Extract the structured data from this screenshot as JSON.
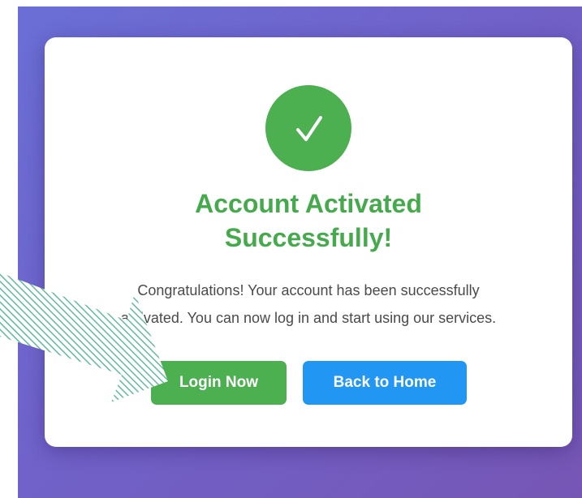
{
  "card": {
    "title_line1": "Account Activated",
    "title_line2": "Successfully!",
    "message_line1": "Congratulations! Your account has been successfully",
    "message_line2": "activated. You can now log in and start using our services.",
    "success_icon": "checkmark-icon"
  },
  "actions": {
    "login_label": "Login Now",
    "home_label": "Back to Home"
  },
  "overlay": {
    "annotation": "hatched-arrow-pointing-to-login"
  },
  "colors": {
    "success_green": "#4caf50",
    "title_green": "#45aa4c",
    "primary_blue": "#2196f3",
    "background_gradient_start": "#6a6fd6",
    "background_gradient_end": "#7656b5",
    "arrow_hatch": "#62b8a0"
  }
}
